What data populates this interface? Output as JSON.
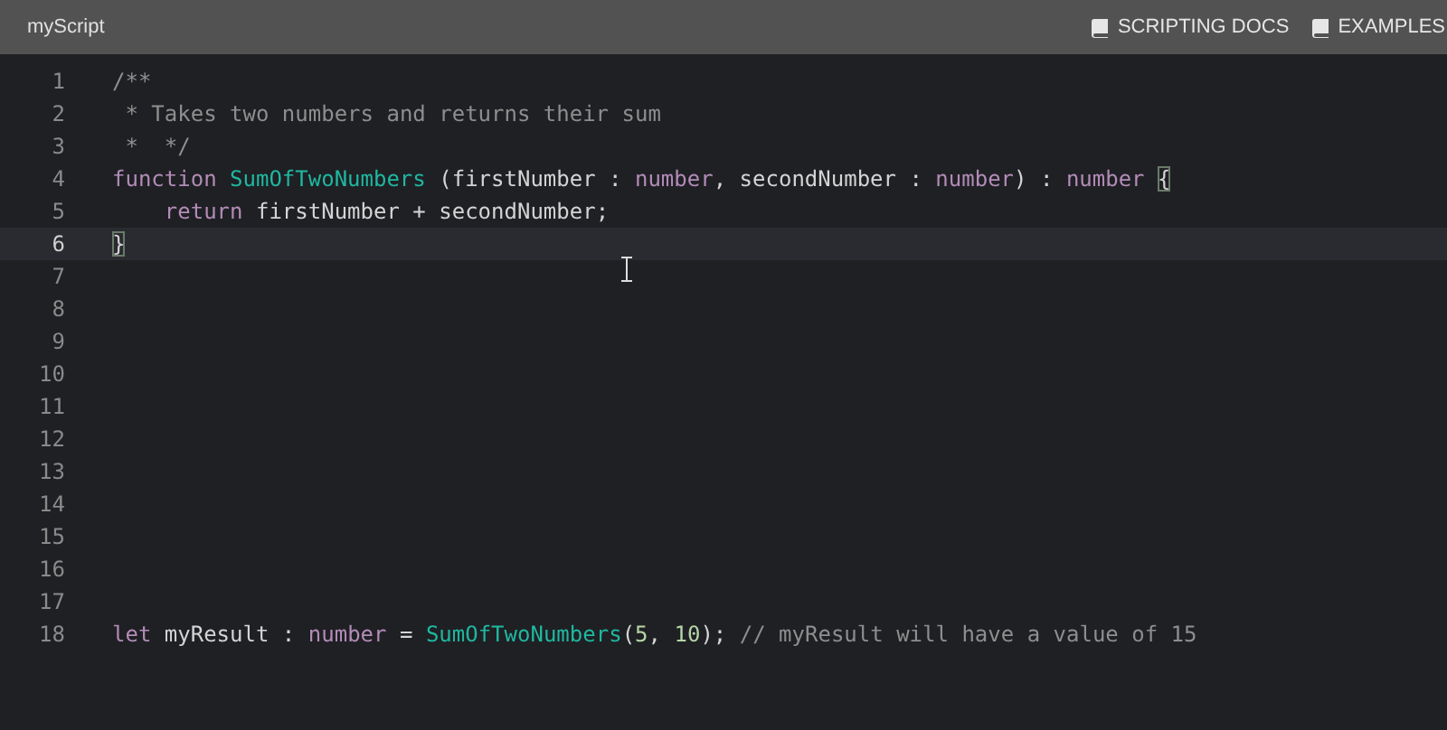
{
  "header": {
    "title": "myScript",
    "links": [
      {
        "label": "SCRIPTING DOCS"
      },
      {
        "label": "EXAMPLES"
      }
    ]
  },
  "editor": {
    "lines": [
      {
        "number": "1",
        "current": false,
        "tokens": [
          {
            "kind": "comment",
            "text": "/**"
          }
        ]
      },
      {
        "number": "2",
        "current": false,
        "tokens": [
          {
            "kind": "comment",
            "text": " * Takes two numbers and returns their sum"
          }
        ]
      },
      {
        "number": "3",
        "current": false,
        "tokens": [
          {
            "kind": "comment",
            "text": " *  */"
          }
        ]
      },
      {
        "number": "4",
        "current": false,
        "tokens": [
          {
            "kind": "keyword",
            "text": "function"
          },
          {
            "kind": "function",
            "text": "SumOfTwoNumbers",
            "space_before": true
          },
          {
            "kind": "plain",
            "text": " (firstNumber : "
          },
          {
            "kind": "keyword",
            "text": "number"
          },
          {
            "kind": "plain",
            "text": ", secondNumber : "
          },
          {
            "kind": "keyword",
            "text": "number"
          },
          {
            "kind": "plain",
            "text": ") : "
          },
          {
            "kind": "keyword",
            "text": "number"
          },
          {
            "kind": "bracket",
            "text": "{",
            "space_before": true
          }
        ]
      },
      {
        "number": "5",
        "current": false,
        "indent": true,
        "tokens": [
          {
            "kind": "keyword",
            "text": "return"
          },
          {
            "kind": "plain",
            "text": " firstNumber + secondNumber;"
          }
        ]
      },
      {
        "number": "6",
        "current": true,
        "tokens": [
          {
            "kind": "bracket",
            "text": "}"
          }
        ]
      },
      {
        "number": "7",
        "current": false
      },
      {
        "number": "8",
        "current": false
      },
      {
        "number": "9",
        "current": false
      },
      {
        "number": "10",
        "current": false
      },
      {
        "number": "11",
        "current": false
      },
      {
        "number": "12",
        "current": false
      },
      {
        "number": "13",
        "current": false
      },
      {
        "number": "14",
        "current": false
      },
      {
        "number": "15",
        "current": false
      },
      {
        "number": "16",
        "current": false
      },
      {
        "number": "17",
        "current": false
      },
      {
        "number": "18",
        "current": false,
        "tokens": [
          {
            "kind": "keyword",
            "text": "let"
          },
          {
            "kind": "plain",
            "text": " myResult : "
          },
          {
            "kind": "keyword",
            "text": "number"
          },
          {
            "kind": "plain",
            "text": " = "
          },
          {
            "kind": "function",
            "text": "SumOfTwoNumbers"
          },
          {
            "kind": "plain",
            "text": "("
          },
          {
            "kind": "number",
            "text": "5"
          },
          {
            "kind": "plain",
            "text": ", "
          },
          {
            "kind": "number",
            "text": "10"
          },
          {
            "kind": "plain",
            "text": "); "
          },
          {
            "kind": "comment",
            "text": "// myResult will have a value of 15"
          }
        ]
      }
    ]
  }
}
